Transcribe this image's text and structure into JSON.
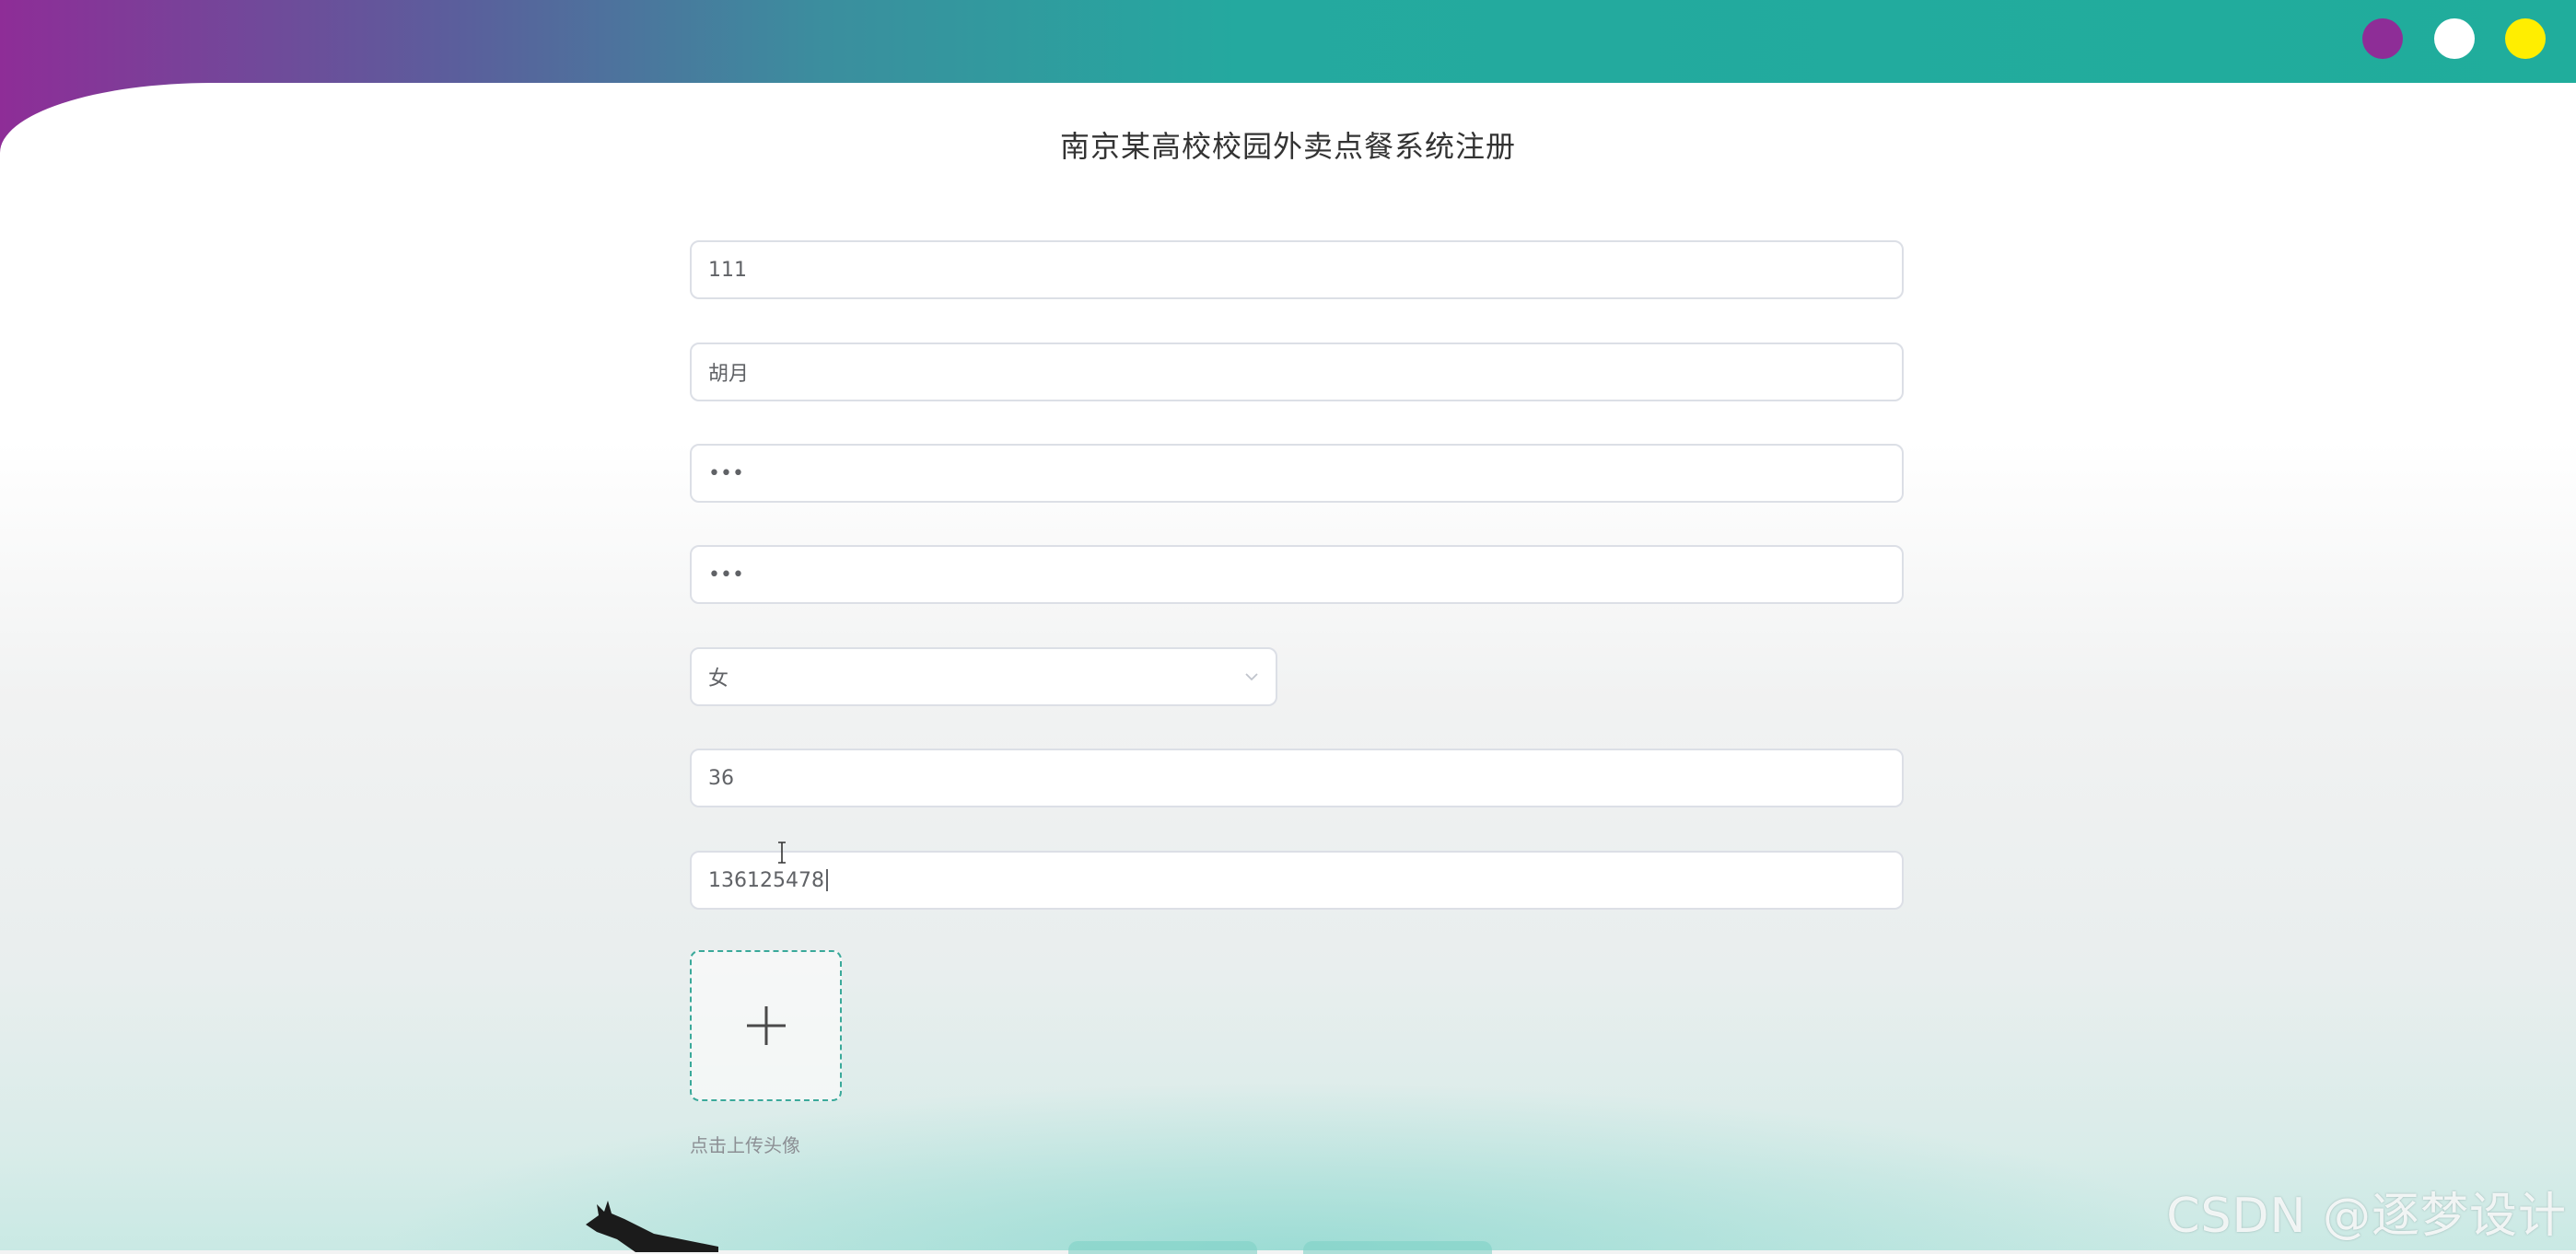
{
  "app": {
    "title": "南京某高校校园外卖点餐系统注册"
  },
  "window_controls": {
    "colors": {
      "purple": "#8e2d97",
      "white": "#ffffff",
      "yellow": "#ffee00"
    }
  },
  "form": {
    "account": {
      "value": "111"
    },
    "name": {
      "value": "胡月"
    },
    "password": {
      "value": "•••"
    },
    "confirm_password": {
      "value": "•••"
    },
    "gender": {
      "selected": "女"
    },
    "age": {
      "value": "36"
    },
    "phone": {
      "value": "136125478"
    },
    "avatar_upload": {
      "icon": "plus-icon",
      "hint": "点击上传头像"
    }
  },
  "watermark": {
    "text": "CSDN @逐梦设计"
  },
  "colors": {
    "accent": "#20ad9c",
    "border": "#dcdfe6",
    "upload_border": "#3aa99a"
  }
}
